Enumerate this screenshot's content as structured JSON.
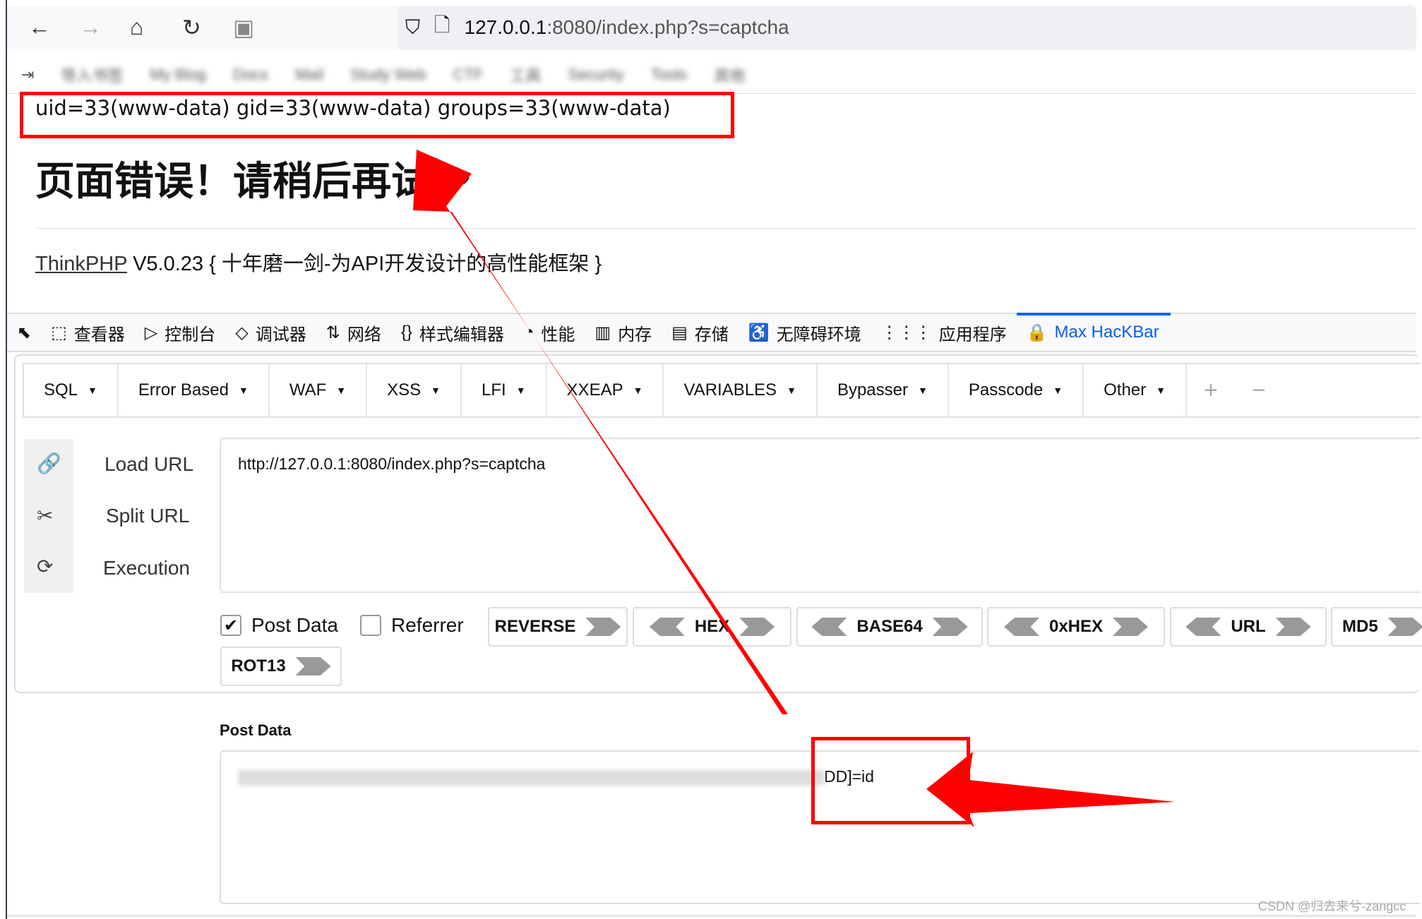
{
  "browser": {
    "url_host": "127.0.0.1",
    "url_rest": ":8080/index.php?s=captcha",
    "bookmarks": [
      "导入书签",
      "My Blog",
      "Docs",
      "Mail",
      "Study Web",
      "CTF",
      "工具",
      "Security",
      "Tools",
      "其他"
    ]
  },
  "page": {
    "command_output": "uid=33(www-data) gid=33(www-data) groups=33(www-data)",
    "error_title": "页面错误！请稍后再试～",
    "framework_link": "ThinkPHP",
    "framework_text": " V5.0.23 { 十年磨一剑-为API开发设计的高性能框架 }"
  },
  "devtools": {
    "tabs": [
      {
        "icon": "⬚",
        "label": "查看器"
      },
      {
        "icon": "▷",
        "label": "控制台"
      },
      {
        "icon": "◇",
        "label": "调试器"
      },
      {
        "icon": "⇅",
        "label": "网络"
      },
      {
        "icon": "{}",
        "label": "样式编辑器"
      },
      {
        "icon": "◔",
        "label": "性能"
      },
      {
        "icon": "▥",
        "label": "内存"
      },
      {
        "icon": "▤",
        "label": "存储"
      },
      {
        "icon": "♿",
        "label": "无障碍环境"
      },
      {
        "icon": "⋮⋮⋮",
        "label": "应用程序"
      },
      {
        "icon": "🔒",
        "label": "Max HacKBar"
      }
    ],
    "accent": "#0a64f0"
  },
  "hackbar": {
    "menu": [
      "SQL",
      "Error Based",
      "WAF",
      "XSS",
      "LFI",
      "XXEAP",
      "VARIABLES",
      "Bypasser",
      "Passcode",
      "Other"
    ],
    "actions": [
      "Load URL",
      "Split URL",
      "Execution"
    ],
    "url_value": "http://127.0.0.1:8080/index.php?s=captcha",
    "post_data_checkbox": "Post Data",
    "post_data_checked": true,
    "referrer_checkbox": "Referrer",
    "referrer_checked": false,
    "encoders": [
      "REVERSE",
      "HEX",
      "BASE64",
      "0xHEX",
      "URL",
      "MD5",
      "ROT13"
    ],
    "post_data_label": "Post Data",
    "post_data_value_visible": "DD]=id"
  },
  "watermark": "CSDN @归去来兮-zangcc",
  "annotation_color": "#ff0000"
}
